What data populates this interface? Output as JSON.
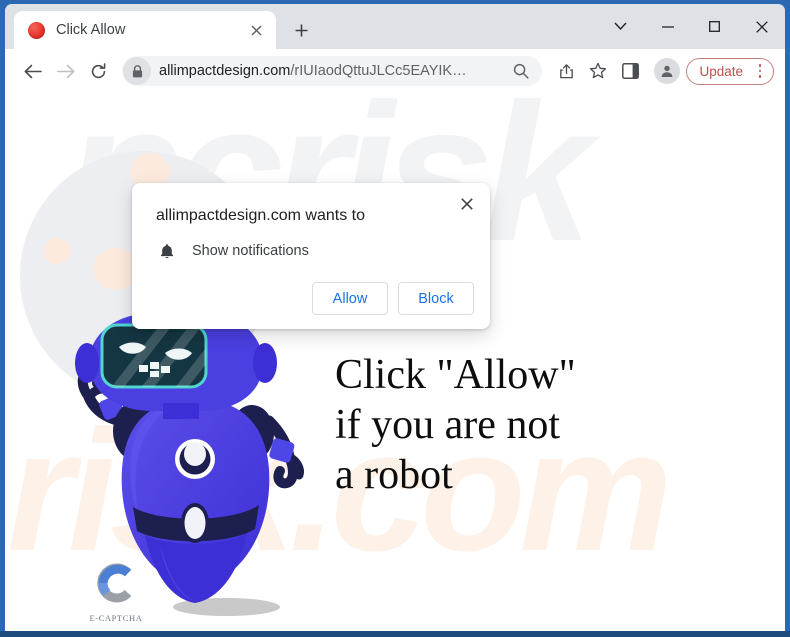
{
  "window": {
    "controls": [
      {
        "name": "tab-search-chevron",
        "glyph": "chevron-down-icon"
      },
      {
        "name": "minimize",
        "glyph": "minimize-icon"
      },
      {
        "name": "maximize",
        "glyph": "maximize-icon"
      },
      {
        "name": "close",
        "glyph": "close-icon"
      }
    ]
  },
  "tab": {
    "title": "Click Allow",
    "favicon": "red-circle-favicon",
    "close_label": "✕",
    "newtab_label": "+"
  },
  "toolbar": {
    "back": "←",
    "forward": "→",
    "reload": "reload-icon",
    "url_main": "allimpactdesign.com",
    "url_path": "/rIUIaodQttuJLCc5EAYIK…",
    "url_full": "allimpactdesign.com/rIUIaodQttuJLCc5EAYIK…",
    "lock": "lock-icon",
    "zoom_search": "search-icon",
    "share": "share-icon",
    "bookmark": "star-icon",
    "sidepanel": "side-panel-icon",
    "profile": "avatar-icon",
    "update_label": "Update",
    "menu": "kebab-menu-icon"
  },
  "permission_dialog": {
    "title": "allimpactdesign.com wants to",
    "item_icon": "bell-icon",
    "item_label": "Show notifications",
    "allow_label": "Allow",
    "block_label": "Block",
    "close_label": "✕"
  },
  "page": {
    "headline": "Click \"Allow\"\nif you are not\na robot",
    "captcha_label": "E-CAPTCHA",
    "watermark_top": "pcrisk",
    "watermark_bottom": "risk.com",
    "robot_alt": "blue-robot-mascot"
  },
  "colors": {
    "accent_blue": "#1a73e8",
    "update_red": "#b5534e",
    "robot_body": "#4a3fe0",
    "robot_body_light": "#5b4fe8",
    "robot_dark": "#1d1f4e",
    "screen_dark": "#143642",
    "screen_border": "#4fd6cf",
    "frame_blue": "#2d68b2",
    "watermark_peach": "#fdf1e8",
    "watermark_gray": "#f1f3f5"
  }
}
